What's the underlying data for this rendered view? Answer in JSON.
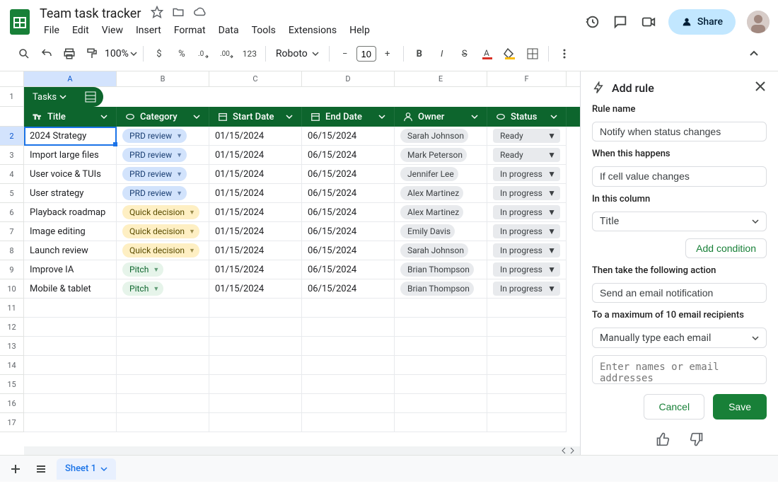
{
  "doc": {
    "title": "Team task tracker"
  },
  "menus": [
    "File",
    "Edit",
    "View",
    "Insert",
    "Format",
    "Data",
    "Tools",
    "Extensions",
    "Help"
  ],
  "share_label": "Share",
  "toolbar": {
    "zoom": "100%",
    "font": "Roboto",
    "font_size": "10"
  },
  "columns": [
    "A",
    "B",
    "C",
    "D",
    "E",
    "F"
  ],
  "tab_name": "Tasks",
  "headers": {
    "title": "Title",
    "category": "Category",
    "start": "Start Date",
    "end": "End Date",
    "owner": "Owner",
    "status": "Status"
  },
  "rows": [
    {
      "n": "2",
      "title": "2024 Strategy",
      "cat": "PRD review",
      "cat_cls": "chip-prd",
      "start": "01/15/2024",
      "end": "06/15/2024",
      "owner": "Sarah Johnson",
      "status": "Ready",
      "status_cls": "chip-ready"
    },
    {
      "n": "3",
      "title": "Import large files",
      "cat": "PRD review",
      "cat_cls": "chip-prd",
      "start": "01/15/2024",
      "end": "06/15/2024",
      "owner": "Mark Peterson",
      "status": "Ready",
      "status_cls": "chip-ready"
    },
    {
      "n": "4",
      "title": "User voice & TUIs",
      "cat": "PRD review",
      "cat_cls": "chip-prd",
      "start": "01/15/2024",
      "end": "06/15/2024",
      "owner": "Jennifer Lee",
      "status": "In progress",
      "status_cls": "chip-inprog"
    },
    {
      "n": "5",
      "title": "User strategy",
      "cat": "PRD review",
      "cat_cls": "chip-prd",
      "start": "01/15/2024",
      "end": "06/15/2024",
      "owner": "Alex Martinez",
      "status": "In progress",
      "status_cls": "chip-inprog"
    },
    {
      "n": "6",
      "title": "Playback roadmap",
      "cat": "Quick decision",
      "cat_cls": "chip-qd",
      "start": "01/15/2024",
      "end": "06/15/2024",
      "owner": "Alex Martinez",
      "status": "In progress",
      "status_cls": "chip-inprog"
    },
    {
      "n": "7",
      "title": "Image editing",
      "cat": "Quick decision",
      "cat_cls": "chip-qd",
      "start": "01/15/2024",
      "end": "06/15/2024",
      "owner": "Emily Davis",
      "status": "In progress",
      "status_cls": "chip-inprog"
    },
    {
      "n": "8",
      "title": "Launch review",
      "cat": "Quick decision",
      "cat_cls": "chip-qd",
      "start": "01/15/2024",
      "end": "06/15/2024",
      "owner": "Sarah Johnson",
      "status": "In progress",
      "status_cls": "chip-inprog"
    },
    {
      "n": "9",
      "title": "Improve IA",
      "cat": "Pitch",
      "cat_cls": "chip-pitch",
      "start": "01/15/2024",
      "end": "06/15/2024",
      "owner": "Brian Thompson",
      "status": "In progress",
      "status_cls": "chip-inprog"
    },
    {
      "n": "10",
      "title": "Mobile & tablet",
      "cat": "Pitch",
      "cat_cls": "chip-pitch",
      "start": "01/15/2024",
      "end": "06/15/2024",
      "owner": "Brian Thompson",
      "status": "In progress",
      "status_cls": "chip-inprog"
    }
  ],
  "empty_rows": [
    "11",
    "12",
    "13",
    "14",
    "15",
    "16",
    "17"
  ],
  "sidepanel": {
    "title": "Add rule",
    "rule_name_label": "Rule name",
    "rule_name_value": "Notify when status changes",
    "when_label": "When this happens",
    "when_value": "If cell value changes",
    "column_label": "In this column",
    "column_value": "Title",
    "add_condition": "Add condition",
    "then_label": "Then take the following action",
    "then_value": "Send an email notification",
    "max_label": "To a maximum of 10 email recipients",
    "max_value": "Manually type each email",
    "email_placeholder": "Enter names or email addresses",
    "cancel": "Cancel",
    "save": "Save"
  },
  "sheet_tab": "Sheet 1"
}
